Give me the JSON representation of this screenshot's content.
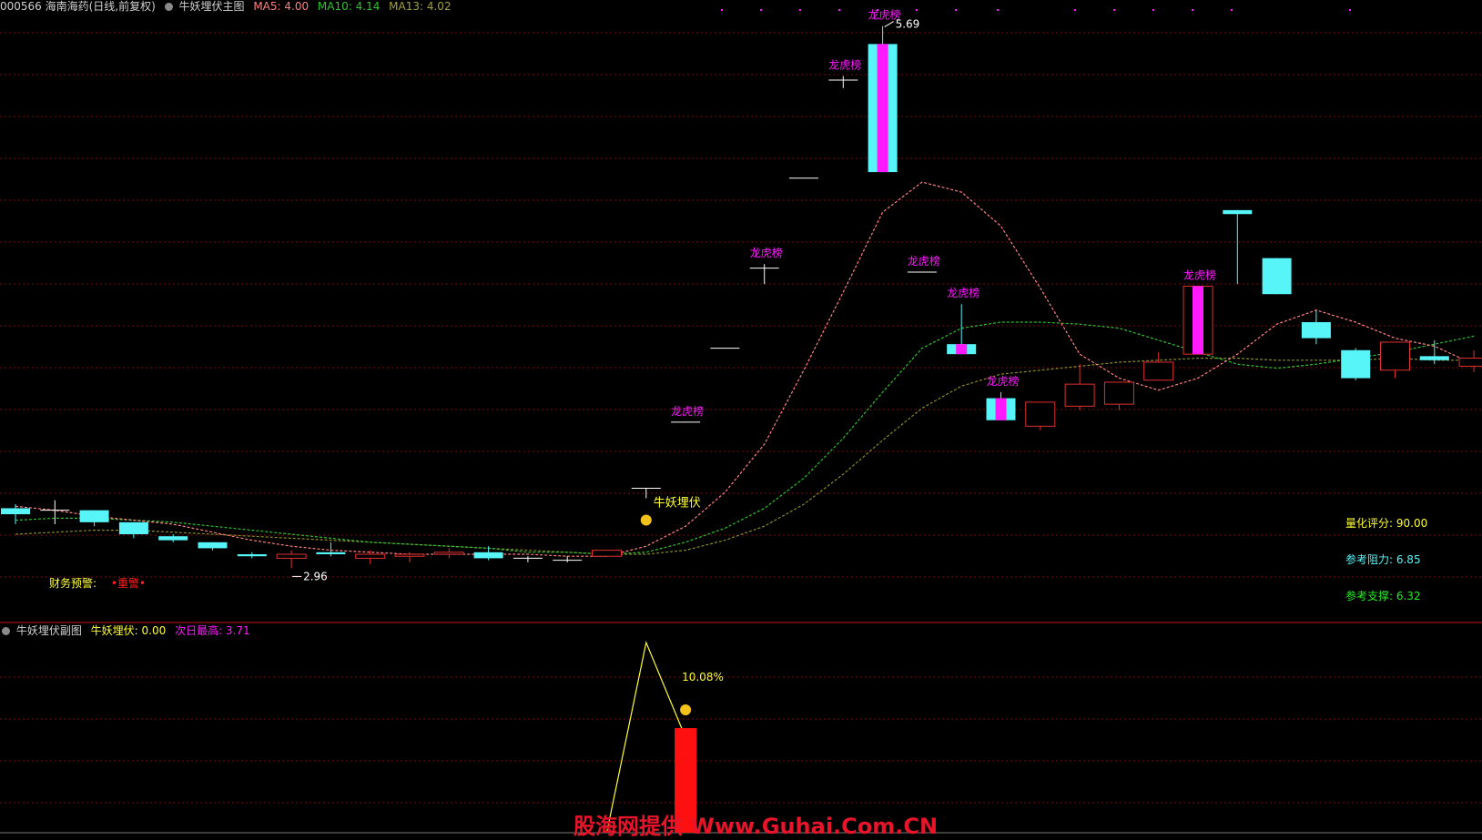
{
  "colors": {
    "background": "#000000",
    "grid": "#7a0a0a",
    "bull": "#e03030",
    "bear": "#57f5f8",
    "magenta": "#ff1aff",
    "ma5": "#ff8080",
    "ma10": "#2fc02f",
    "ma13": "#8a8a2a",
    "yellow": "#ffff33",
    "white": "#ffffff",
    "green_text": "#22ee22",
    "cyan_text": "#57f5f8",
    "divider": "#c81414"
  },
  "main_header": {
    "stock": "000566 海南海药(日线,前复权)",
    "panel_name": "牛妖埋伏主图",
    "ma5": "MA5: 4.00",
    "ma10": "MA10: 4.14",
    "ma13": "MA13: 4.02"
  },
  "sub_header": {
    "panel_name": "牛妖埋伏副图",
    "ambush": "牛妖埋伏: 0.00",
    "next_high": "次日最高: 3.71"
  },
  "main_labels": {
    "high_marker": "5.69",
    "low_marker": "2.96",
    "signal": "牛妖埋伏",
    "finance_warning_label": "财务预警:",
    "finance_warning_value": "•重警•",
    "score": "量化评分: 90.00",
    "resistance": "参考阻力: 6.85",
    "support": "参考支撑: 6.32",
    "dragon": "龙虎榜"
  },
  "sub_labels": {
    "percent": "10.08%"
  },
  "watermark": "股海网提供 Www.Guhai.Com.CN",
  "chart_data": {
    "type": "candlestick",
    "price_ylim": [
      2.9,
      5.72
    ],
    "candles": [
      {
        "o": 3.28,
        "h": 3.3,
        "l": 3.2,
        "c": 3.25
      },
      {
        "o": 3.27,
        "h": 3.32,
        "l": 3.2,
        "c": 3.27
      },
      {
        "o": 3.27,
        "h": 3.27,
        "l": 3.19,
        "c": 3.21
      },
      {
        "o": 3.21,
        "h": 3.21,
        "l": 3.13,
        "c": 3.15
      },
      {
        "o": 3.14,
        "h": 3.15,
        "l": 3.11,
        "c": 3.12
      },
      {
        "o": 3.11,
        "h": 3.11,
        "l": 3.07,
        "c": 3.08
      },
      {
        "o": 3.05,
        "h": 3.06,
        "l": 3.03,
        "c": 3.04
      },
      {
        "o": 3.03,
        "h": 3.07,
        "l": 2.98,
        "c": 3.05
      },
      {
        "o": 3.06,
        "h": 3.11,
        "l": 3.04,
        "c": 3.05
      },
      {
        "o": 3.03,
        "h": 3.07,
        "l": 3.0,
        "c": 3.05
      },
      {
        "o": 3.04,
        "h": 3.06,
        "l": 3.01,
        "c": 3.05
      },
      {
        "o": 3.05,
        "h": 3.08,
        "l": 3.03,
        "c": 3.06
      },
      {
        "o": 3.06,
        "h": 3.09,
        "l": 3.02,
        "c": 3.03
      },
      {
        "o": 3.03,
        "h": 3.04,
        "l": 3.01,
        "c": 3.03
      },
      {
        "o": 3.02,
        "h": 3.04,
        "l": 3.01,
        "c": 3.02
      },
      {
        "o": 3.04,
        "h": 3.07,
        "l": 3.04,
        "c": 3.07
      },
      {
        "o": 3.38,
        "h": 3.38,
        "l": 3.33,
        "c": 3.38
      },
      {
        "o": 3.71,
        "h": 3.71,
        "l": 3.71,
        "c": 3.71
      },
      {
        "o": 4.08,
        "h": 4.08,
        "l": 4.08,
        "c": 4.08
      },
      {
        "o": 4.48,
        "h": 4.5,
        "l": 4.4,
        "c": 4.48
      },
      {
        "o": 4.93,
        "h": 4.93,
        "l": 4.93,
        "c": 4.93
      },
      {
        "o": 5.42,
        "h": 5.44,
        "l": 5.38,
        "c": 5.42
      },
      {
        "o": 5.6,
        "h": 5.69,
        "l": 4.96,
        "c": 4.96
      },
      {
        "o": 4.46,
        "h": 4.46,
        "l": 4.46,
        "c": 4.46
      },
      {
        "o": 4.1,
        "h": 4.3,
        "l": 4.05,
        "c": 4.05
      },
      {
        "o": 3.83,
        "h": 3.86,
        "l": 3.72,
        "c": 3.72
      },
      {
        "o": 3.69,
        "h": 3.8,
        "l": 3.67,
        "c": 3.81
      },
      {
        "o": 3.79,
        "h": 4.0,
        "l": 3.77,
        "c": 3.9
      },
      {
        "o": 3.8,
        "h": 3.9,
        "l": 3.77,
        "c": 3.91
      },
      {
        "o": 3.92,
        "h": 4.06,
        "l": 3.92,
        "c": 4.01
      },
      {
        "o": 4.05,
        "h": 4.39,
        "l": 4.05,
        "c": 4.39
      },
      {
        "o": 4.77,
        "h": 4.77,
        "l": 4.4,
        "c": 4.75
      },
      {
        "o": 4.53,
        "h": 4.53,
        "l": 4.35,
        "c": 4.35
      },
      {
        "o": 4.21,
        "h": 4.27,
        "l": 4.1,
        "c": 4.13
      },
      {
        "o": 4.07,
        "h": 4.08,
        "l": 3.92,
        "c": 3.93
      },
      {
        "o": 3.97,
        "h": 4.11,
        "l": 3.93,
        "c": 4.11
      },
      {
        "o": 4.04,
        "h": 4.12,
        "l": 4.0,
        "c": 4.02
      },
      {
        "o": 3.99,
        "h": 4.07,
        "l": 3.96,
        "c": 4.03
      }
    ],
    "ma5": [
      3.29,
      3.27,
      3.24,
      3.22,
      3.2,
      3.16,
      3.12,
      3.09,
      3.07,
      3.06,
      3.05,
      3.05,
      3.05,
      3.05,
      3.04,
      3.04,
      3.09,
      3.19,
      3.36,
      3.6,
      3.97,
      4.36,
      4.76,
      4.91,
      4.86,
      4.69,
      4.38,
      4.05,
      3.93,
      3.87,
      3.93,
      4.05,
      4.2,
      4.27,
      4.21,
      4.13,
      4.09,
      4.0
    ],
    "ma10": [
      3.22,
      3.23,
      3.23,
      3.22,
      3.21,
      3.19,
      3.17,
      3.15,
      3.13,
      3.11,
      3.1,
      3.09,
      3.08,
      3.06,
      3.06,
      3.05,
      3.06,
      3.11,
      3.18,
      3.28,
      3.43,
      3.63,
      3.86,
      4.08,
      4.18,
      4.21,
      4.21,
      4.2,
      4.18,
      4.12,
      4.06,
      4.0,
      3.98,
      4.0,
      4.03,
      4.06,
      4.1,
      4.14
    ],
    "ma13": [
      3.15,
      3.16,
      3.17,
      3.17,
      3.16,
      3.15,
      3.14,
      3.13,
      3.12,
      3.11,
      3.1,
      3.09,
      3.08,
      3.07,
      3.06,
      3.05,
      3.05,
      3.07,
      3.12,
      3.19,
      3.3,
      3.45,
      3.62,
      3.78,
      3.89,
      3.95,
      3.97,
      3.99,
      4.01,
      4.02,
      4.03,
      4.03,
      4.02,
      4.02,
      4.02,
      4.03,
      4.02,
      4.02
    ],
    "dragon_board_days": [
      17,
      19,
      21,
      22,
      23,
      24,
      25,
      30
    ],
    "sub_panel": {
      "ylim": [
        0,
        10
      ],
      "series": [
        {
          "values_at": [
            [
              15,
              0
            ],
            [
              16,
              10
            ],
            [
              17,
              5
            ]
          ]
        }
      ],
      "bar": {
        "index": 17,
        "value": 5.5
      }
    }
  }
}
